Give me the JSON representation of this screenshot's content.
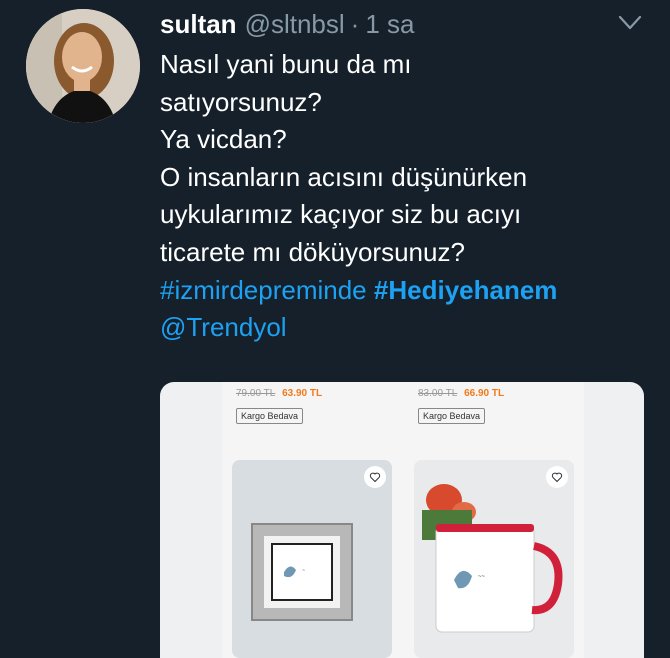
{
  "tweet": {
    "display_name": "sultan",
    "handle": "@sltnbsl",
    "separator": "·",
    "time": "1 sa",
    "lines": [
      "Nasıl yani bunu da mı",
      "satıyorsunuz?",
      "Ya vicdan?",
      "O insanların acısını düşünürken",
      "uykularımız kaçıyor siz bu acıyı",
      "ticarete mı döküyorsunuz?"
    ],
    "hashtag_1": "#izmirdepreminde",
    "hashtag_2": "#Hediyehanem",
    "mention": "@Trendyol"
  },
  "media": {
    "products": [
      {
        "old_price": "79.00 TL",
        "new_price": "63.90 TL",
        "badge": "Kargo Bedava",
        "image_icon": "framed-print-image"
      },
      {
        "old_price": "83.00 TL",
        "new_price": "66.90 TL",
        "badge": "Kargo Bedava",
        "image_icon": "mug-with-flowers-image"
      }
    ]
  },
  "colors": {
    "background": "#15202b",
    "link": "#1da1f2",
    "secondary_text": "#8899a6",
    "price_accent": "#f27a1a"
  }
}
